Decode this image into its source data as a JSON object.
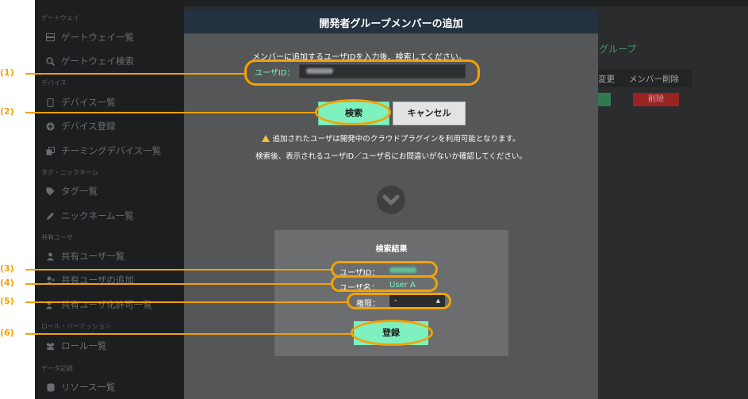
{
  "sidebar": {
    "sections": [
      {
        "label": "ゲートウェイ",
        "items": [
          {
            "label": "ゲートウェイ一覧",
            "icon": "server-icon"
          },
          {
            "label": "ゲートウェイ検索",
            "icon": "search-icon"
          }
        ]
      },
      {
        "label": "デバイス",
        "items": [
          {
            "label": "デバイス一覧",
            "icon": "device-icon"
          },
          {
            "label": "デバイス登録",
            "icon": "plus-circle-icon"
          },
          {
            "label": "チーミングデバイス一覧",
            "icon": "clone-icon"
          }
        ]
      },
      {
        "label": "タグ・ニックネーム",
        "items": [
          {
            "label": "タグ一覧",
            "icon": "tag-icon"
          },
          {
            "label": "ニックネーム一覧",
            "icon": "pencil-icon"
          }
        ]
      },
      {
        "label": "共有ユーザ",
        "items": [
          {
            "label": "共有ユーザ一覧",
            "icon": "user-icon"
          },
          {
            "label": "共有ユーザの追加",
            "icon": "user-plus-icon"
          },
          {
            "label": "共有ユーザ化許可一覧",
            "icon": "user-check-icon"
          }
        ]
      },
      {
        "label": "ロール・パーミッション",
        "items": [
          {
            "label": "ロール一覧",
            "icon": "users-icon"
          }
        ]
      },
      {
        "label": "データ記録",
        "items": [
          {
            "label": "リソース一覧",
            "icon": "database-icon"
          }
        ]
      }
    ]
  },
  "background": {
    "title": "グループ",
    "col_change": "変更",
    "col_member_delete": "メンバー削除",
    "delete_label": "削除"
  },
  "modal": {
    "title": "開発者グループメンバーの追加",
    "prompt": "メンバーに追加するユーザIDを入力後、検索してください。",
    "user_id_label": "ユーザID：",
    "search_button": "検索",
    "cancel_button": "キャンセル",
    "warning_line1": "追加されたユーザは開発中のクラウドプラグインを利用可能となります。",
    "warning_line2": "検索後、表示されるユーザID／ユーザ名にお間違いがないか確認してください。",
    "result": {
      "title": "検索結果",
      "user_id_label": "ユーザID：",
      "user_name_label": "ユーザ名：",
      "user_name_value": "User A",
      "permission_label": "権限：",
      "permission_value": "-",
      "register_button": "登録"
    }
  },
  "annotations": {
    "labels": [
      "(1)",
      "(2)",
      "(3)",
      "(4)",
      "(5)",
      "(6)"
    ],
    "color": "#f5a200"
  },
  "colors": {
    "accent_green": "#7ff1c0",
    "label_green": "#7cf5c0",
    "header_navy": "#243140",
    "delete_red": "#9a2323"
  }
}
